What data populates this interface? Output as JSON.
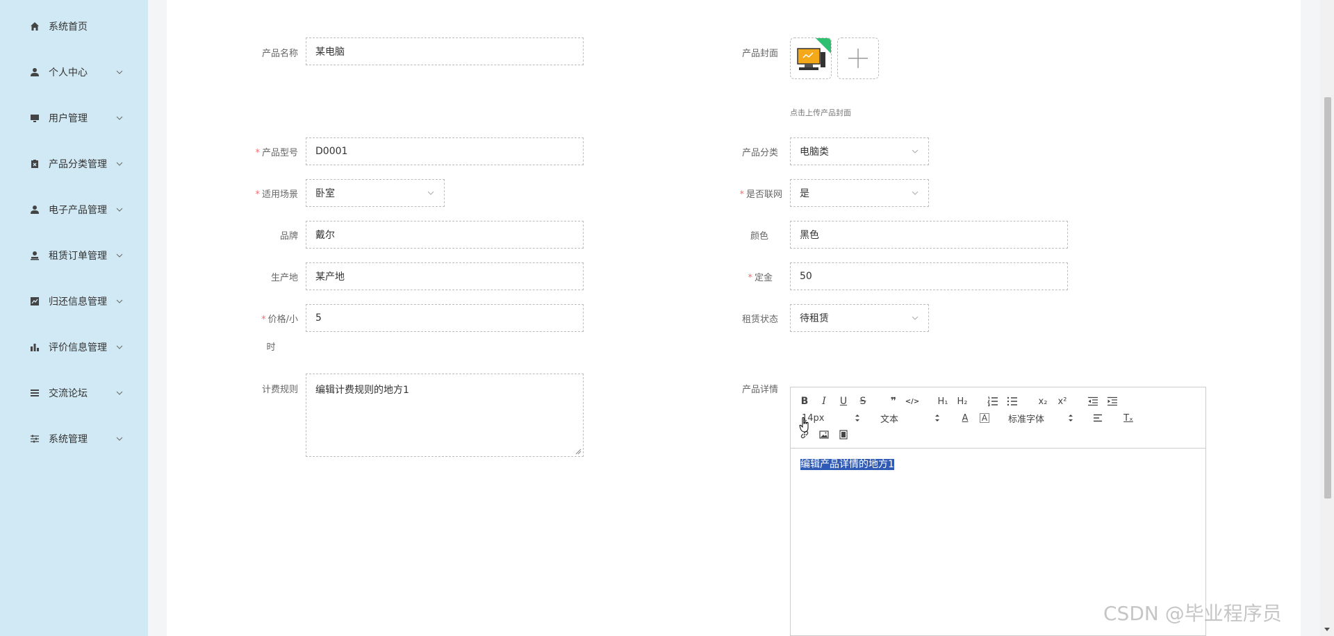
{
  "sidebar": {
    "items": [
      {
        "label": "系统首页",
        "icon": "home-icon",
        "has_caret": false
      },
      {
        "label": "个人中心",
        "icon": "user-icon",
        "has_caret": true
      },
      {
        "label": "用户管理",
        "icon": "monitor-icon",
        "has_caret": true
      },
      {
        "label": "产品分类管理",
        "icon": "clipboard-icon",
        "has_caret": true
      },
      {
        "label": "电子产品管理",
        "icon": "user-icon",
        "has_caret": true
      },
      {
        "label": "租赁订单管理",
        "icon": "stamp-icon",
        "has_caret": true
      },
      {
        "label": "归还信息管理",
        "icon": "chart-line-icon",
        "has_caret": true
      },
      {
        "label": "评价信息管理",
        "icon": "bar-chart-icon",
        "has_caret": true
      },
      {
        "label": "交流论坛",
        "icon": "list-icon",
        "has_caret": true
      },
      {
        "label": "系统管理",
        "icon": "sliders-icon",
        "has_caret": true
      }
    ]
  },
  "form": {
    "product_name": {
      "label": "产品名称",
      "value": "某电脑"
    },
    "cover": {
      "label": "产品封面",
      "hint": "点击上传产品封面"
    },
    "model": {
      "label": "产品型号",
      "value": "D0001"
    },
    "category": {
      "label": "产品分类",
      "value": "电脑类"
    },
    "scene": {
      "label": "适用场景",
      "value": "卧室"
    },
    "online": {
      "label": "是否联网",
      "value": "是"
    },
    "brand": {
      "label": "品牌",
      "value": "戴尔"
    },
    "color": {
      "label": "颜色",
      "value": "黑色"
    },
    "origin": {
      "label": "生产地",
      "value": "某产地"
    },
    "deposit": {
      "label": "定金",
      "value": "50"
    },
    "price_line1": "价格/小",
    "price_line2": "时",
    "price_value": "5",
    "status": {
      "label": "租赁状态",
      "value": "待租赁"
    },
    "billing": {
      "label": "计费规则",
      "value": "编辑计费规则的地方1"
    },
    "detail": {
      "label": "产品详情",
      "value": "编辑产品详情的地方1"
    }
  },
  "editor": {
    "font_size": "14px",
    "block_type": "文本",
    "font_family": "标准字体",
    "tb_bold": "B",
    "tb_italic": "I",
    "tb_underline": "U",
    "tb_strike": "S",
    "tb_quote": "❞",
    "tb_code": "</>",
    "tb_h1": "H₁",
    "tb_h2": "H₂",
    "tb_sub": "x₂",
    "tb_sup": "x²",
    "tb_color": "A",
    "tb_bg": "A",
    "tb_clear": "Tₓ"
  },
  "watermark": "CSDN @毕业程序员",
  "colors": {
    "sidebar_bg": "#d1e9f4",
    "required": "#f56c6c",
    "selection": "#2f5bb7"
  }
}
